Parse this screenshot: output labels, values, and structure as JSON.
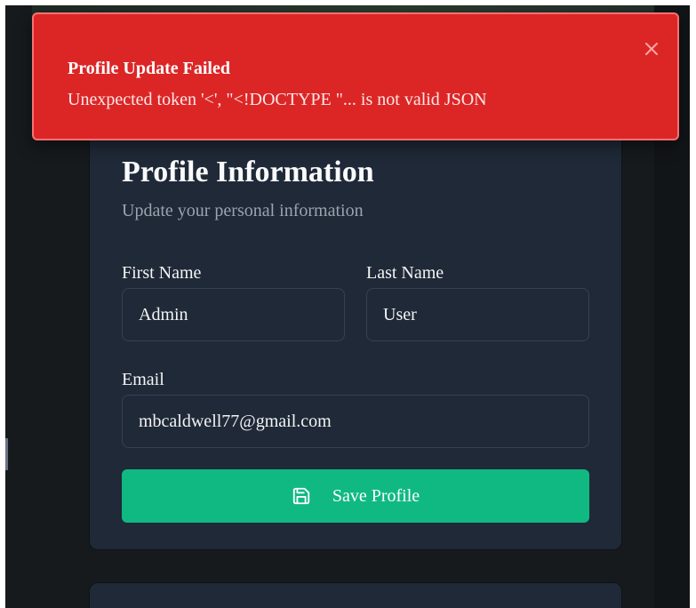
{
  "toast": {
    "title": "Profile Update Failed",
    "message": "Unexpected token '<', \"<!DOCTYPE \"... is not valid JSON",
    "close_icon": "close-icon",
    "color": "#dc2626"
  },
  "profile_card": {
    "title": "Profile Information",
    "subtitle": "Update your personal information",
    "first_name": {
      "label": "First Name",
      "value": "Admin"
    },
    "last_name": {
      "label": "Last Name",
      "value": "User"
    },
    "email": {
      "label": "Email",
      "value": "mbcaldwell77@gmail.com"
    },
    "save_button": {
      "label": "Save Profile",
      "icon": "save-icon",
      "color": "#10b981"
    }
  }
}
